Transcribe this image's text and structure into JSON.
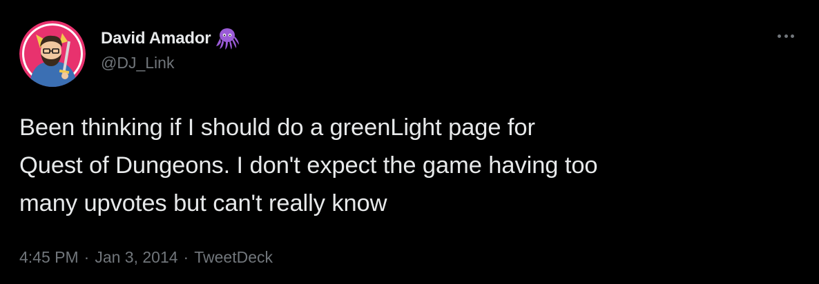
{
  "author": {
    "display_name": "David Amador",
    "handle": "@DJ_Link",
    "badge_icon": "octopus-emoji-icon",
    "avatar_icon": "profile-avatar"
  },
  "tweet": {
    "text": "Been thinking if I should do a greenLight page for\nQuest of Dungeons. I don't expect the game having too\nmany upvotes but can't really know"
  },
  "meta": {
    "time": "4:45 PM",
    "separator": "·",
    "date": "Jan 3, 2014",
    "source": "TweetDeck"
  },
  "menu": {
    "icon": "more-options-icon"
  },
  "colors": {
    "background": "#000000",
    "primary_text": "#e7e9ea",
    "secondary_text": "#71767b",
    "avatar_bg": "#e8326e",
    "octopus": "#9a5bd6"
  }
}
